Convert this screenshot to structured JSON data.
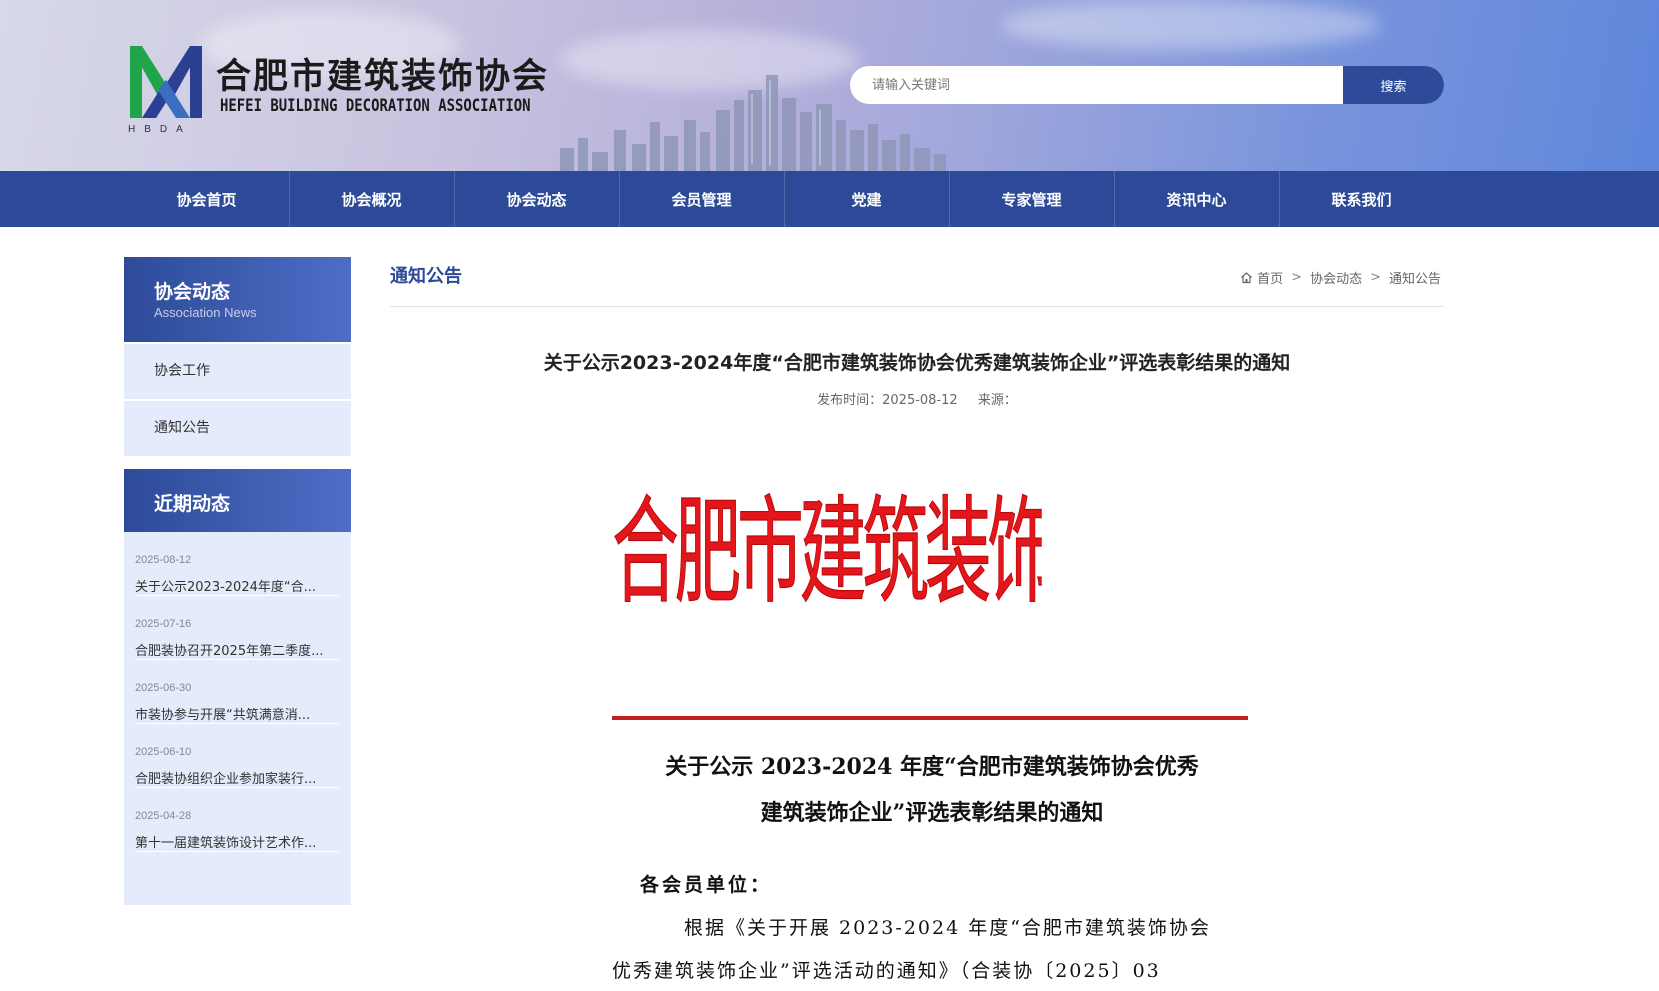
{
  "header": {
    "org_name_cn": "合肥市建筑装饰协会",
    "org_name_en": "HEFEI BUILDING DECORATION ASSOCIATION",
    "org_abbr": "HBDA",
    "search": {
      "placeholder": "请输入关键词",
      "button_label": "搜索"
    }
  },
  "nav": {
    "items": [
      {
        "label": "协会首页"
      },
      {
        "label": "协会概况"
      },
      {
        "label": "协会动态"
      },
      {
        "label": "会员管理"
      },
      {
        "label": "党建"
      },
      {
        "label": "专家管理"
      },
      {
        "label": "资讯中心"
      },
      {
        "label": "联系我们"
      }
    ]
  },
  "sidebar": {
    "section_title": "协会动态",
    "section_subtitle": "Association News",
    "links": [
      {
        "label": "协会工作"
      },
      {
        "label": "通知公告"
      }
    ],
    "recent_title": "近期动态",
    "recent": [
      {
        "date": "2025-08-12",
        "title": "关于公示2023-2024年度“合..."
      },
      {
        "date": "2025-07-16",
        "title": "合肥装协召开2025年第二季度..."
      },
      {
        "date": "2025-06-30",
        "title": "市装协参与开展“共筑满意消..."
      },
      {
        "date": "2025-06-10",
        "title": "合肥装协组织企业参加家装行..."
      },
      {
        "date": "2025-04-28",
        "title": "第十一届建筑装饰设计艺术作..."
      }
    ]
  },
  "main": {
    "category_title": "通知公告",
    "breadcrumb": {
      "home": "首页",
      "level1": "协会动态",
      "level2": "通知公告",
      "sep": ">"
    },
    "article": {
      "title": "关于公示2023-2024年度“合肥市建筑装饰协会优秀建筑装饰企业”评选表彰结果的通知",
      "publish_label": "发布时间：",
      "publish_date": "2025-08-12",
      "source_label": "来源："
    },
    "document": {
      "letterhead": "合肥市建筑装饰协会",
      "title_line1": "关于公示 2023-2024 年度“合肥市建筑装饰协会优秀",
      "title_line2": "建筑装饰企业”评选表彰结果的通知",
      "greeting": "各会员单位：",
      "para1_line1": "根据《关于开展 2023-2024 年度“合肥市建筑装饰协会",
      "para1_line2": "优秀建筑装饰企业”评选活动的通知》（合装协〔2025〕03"
    }
  },
  "colors": {
    "nav_bg": "#2c4a98",
    "accent_blue": "#2d4b99",
    "sidebar_bg": "#e4ebfb",
    "letterhead_red": "#e3161b",
    "logo_green": "#1fa64a"
  }
}
